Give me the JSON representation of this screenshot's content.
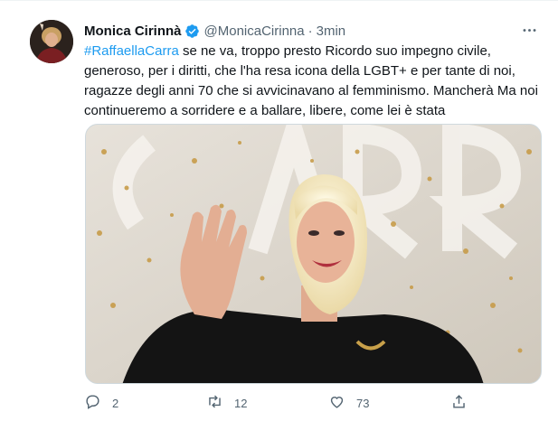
{
  "tweet": {
    "author_name": "Monica Cirinnà",
    "handle": "@MonicaCirinna",
    "separator": "·",
    "time": "3min",
    "hashtag": "#RaffaellaCarra",
    "body": " se ne va, troppo presto Ricordo suo impegno civile, generoso, per i diritti, che l'ha resa icona della LGBT+ e per tante di noi, ragazze degli anni 70 che si avvicinavano al femminismo. Mancherà Ma noi continueremo a sorridere e a ballare, libere, come lei è stata",
    "replies": "2",
    "retweets": "12",
    "likes": "73"
  },
  "colors": {
    "link": "#1d9bf0",
    "secondary_text": "#536471",
    "verified": "#1d9bf0"
  },
  "icons": [
    "verified-badge-icon",
    "more-icon",
    "reply-icon",
    "retweet-icon",
    "like-icon",
    "share-icon"
  ]
}
